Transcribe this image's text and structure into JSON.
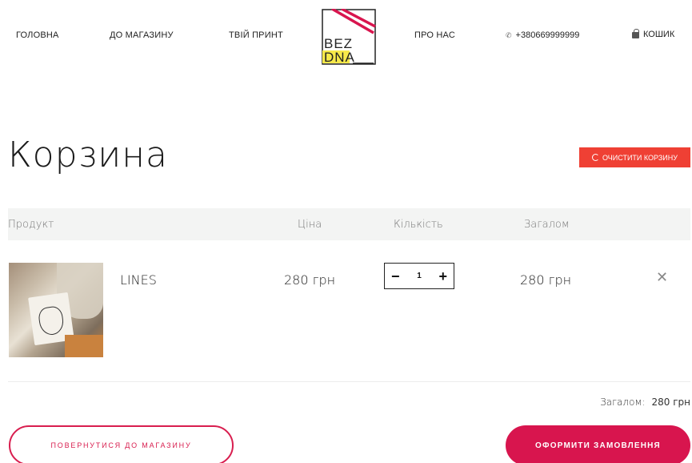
{
  "header": {
    "nav": [
      "ГОЛОВНА",
      "ДО МАГАЗИНУ",
      "ТВІЙ ПРИНТ",
      "ПРО НАС"
    ],
    "logo_line1": "BEZ",
    "logo_line2": "DNA",
    "phone": "+380669999999",
    "cart_label": "КОШИК"
  },
  "page": {
    "title": "Корзина",
    "clear_label": "ОЧИСТИТИ КОРЗИНУ"
  },
  "table": {
    "columns": [
      "Продукт",
      "Ціна",
      "Кількість",
      "Загалом"
    ],
    "rows": [
      {
        "name": "LINES",
        "price": "280 грн",
        "quantity": "1",
        "total": "280 грн"
      }
    ]
  },
  "summary": {
    "label": "Загалом:",
    "value": "280 грн"
  },
  "actions": {
    "back_label": "ПОВЕРНУТИСЯ ДО МАГАЗИНУ",
    "order_label": "ОФОРМИТИ ЗАМОВЛЕННЯ"
  },
  "colors": {
    "accent": "#d8154e",
    "clear_button": "#ef4034",
    "logo_yellow": "#f7e94a"
  },
  "icons": [
    "phone-icon",
    "bag-icon",
    "refresh-icon",
    "minus-icon",
    "plus-icon",
    "close-icon"
  ]
}
